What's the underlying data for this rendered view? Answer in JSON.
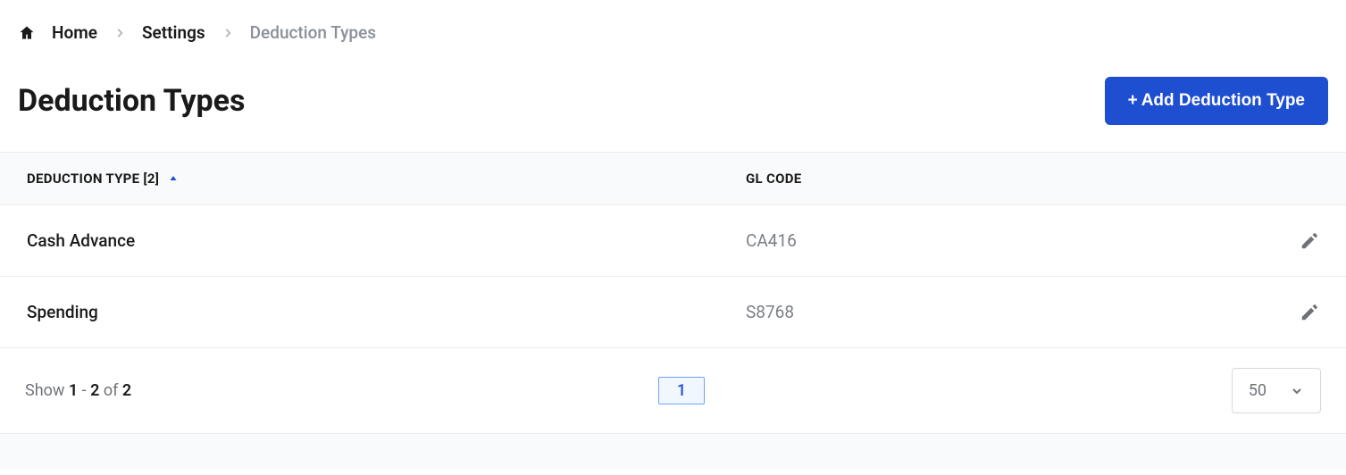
{
  "breadcrumbs": {
    "home": "Home",
    "settings": "Settings",
    "current": "Deduction Types"
  },
  "page": {
    "title": "Deduction Types",
    "add_button": "Add Deduction Type"
  },
  "table": {
    "count": "2",
    "col_type_label": "DEDUCTION TYPE",
    "col_gl_label": "GL CODE",
    "rows": [
      {
        "type": "Cash Advance",
        "gl": "CA416"
      },
      {
        "type": "Spending",
        "gl": "S8768"
      }
    ]
  },
  "pagination": {
    "show_prefix": "Show ",
    "range_start": "1",
    "dash": " - ",
    "range_end": "2",
    "of": " of ",
    "total": "2",
    "current_page": "1",
    "page_size": "50"
  }
}
